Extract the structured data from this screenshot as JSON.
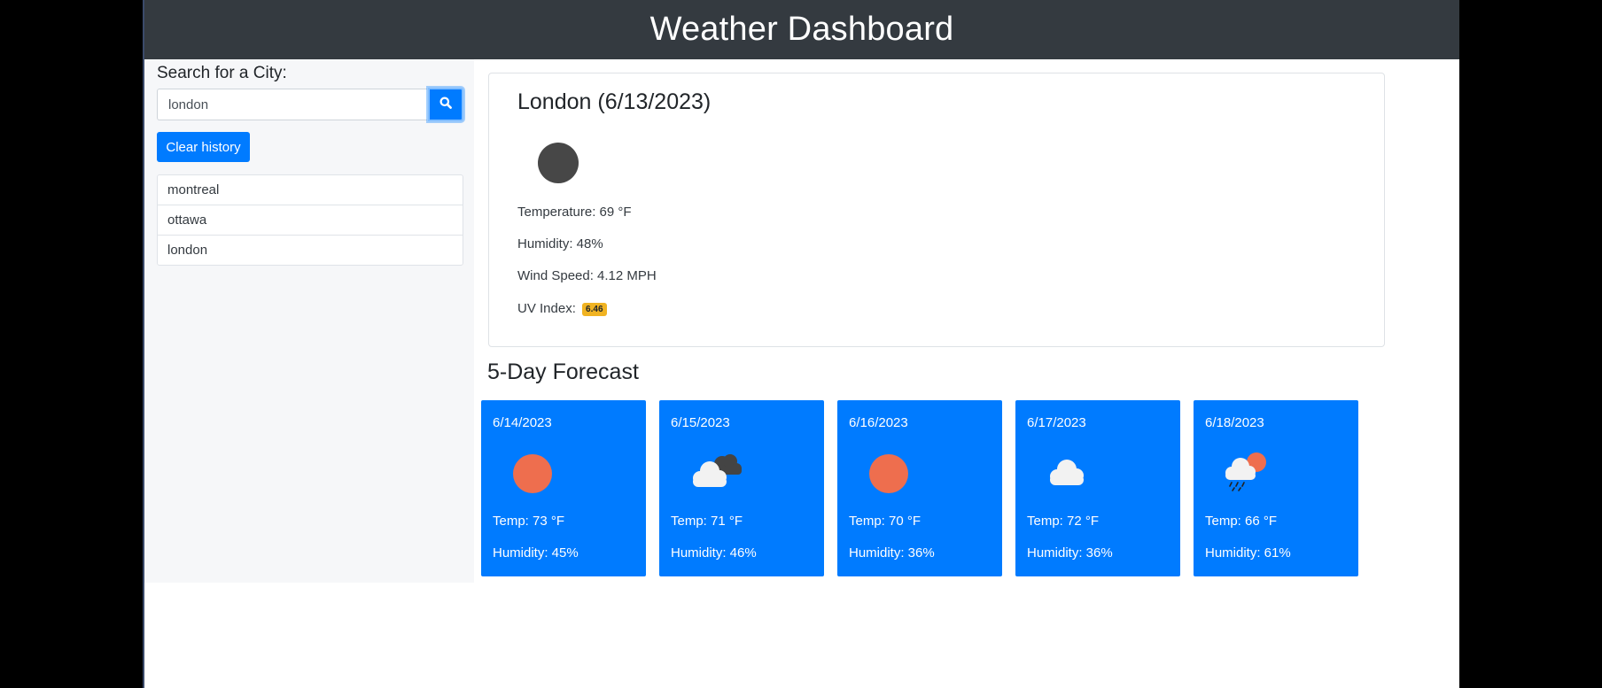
{
  "header": {
    "title": "Weather Dashboard"
  },
  "sidebar": {
    "search_label": "Search for a City:",
    "search_value": "london",
    "search_button_icon": "search-icon",
    "clear_label": "Clear history",
    "history": [
      "montreal",
      "ottawa",
      "london"
    ]
  },
  "current": {
    "title": "London (6/13/2023)",
    "icon": "moon-icon",
    "temperature": "Temperature: 69 °F",
    "humidity": "Humidity: 48%",
    "wind": "Wind Speed: 4.12 MPH",
    "uv_label": "UV Index:",
    "uv_value": "6.46",
    "uv_color": "#f0b322"
  },
  "forecast": {
    "title": "5-Day Forecast",
    "card_color": "#007bff",
    "days": [
      {
        "date": "6/14/2023",
        "icon": "sun-icon",
        "temp": "Temp: 73 °F",
        "humidity": "Humidity: 45%"
      },
      {
        "date": "6/15/2023",
        "icon": "cloudy-icon",
        "temp": "Temp: 71 °F",
        "humidity": "Humidity: 46%"
      },
      {
        "date": "6/16/2023",
        "icon": "sun-icon",
        "temp": "Temp: 70 °F",
        "humidity": "Humidity: 36%"
      },
      {
        "date": "6/17/2023",
        "icon": "cloud-icon",
        "temp": "Temp: 72 °F",
        "humidity": "Humidity: 36%"
      },
      {
        "date": "6/18/2023",
        "icon": "rain-sun-icon",
        "temp": "Temp: 66 °F",
        "humidity": "Humidity: 61%"
      }
    ]
  }
}
